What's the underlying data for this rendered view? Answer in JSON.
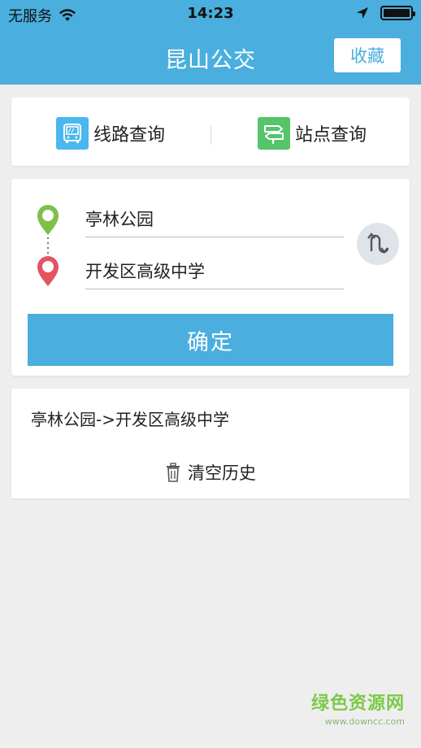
{
  "status": {
    "carrier": "无服务",
    "time": "14:23",
    "icons": [
      "wifi-icon",
      "location-arrow-icon",
      "battery-icon"
    ]
  },
  "nav": {
    "title": "昆山公交",
    "favorite_label": "收藏"
  },
  "tabs": [
    {
      "label": "线路查询",
      "icon": "bus-icon",
      "color": "#4ab7ee"
    },
    {
      "label": "站点查询",
      "icon": "signpost-icon",
      "color": "#55c46a"
    }
  ],
  "search": {
    "start": "亭林公园",
    "end": "开发区高级中学",
    "confirm_label": "确定",
    "start_pin_color": "#7cc14a",
    "end_pin_color": "#e25560"
  },
  "history": {
    "items": [
      "亭林公园->开发区高级中学"
    ],
    "clear_label": "清空历史"
  },
  "watermark": {
    "title": "绿色资源网",
    "url": "www.downcc.com"
  },
  "colors": {
    "primary": "#4aaede",
    "background": "#eeeeee"
  }
}
